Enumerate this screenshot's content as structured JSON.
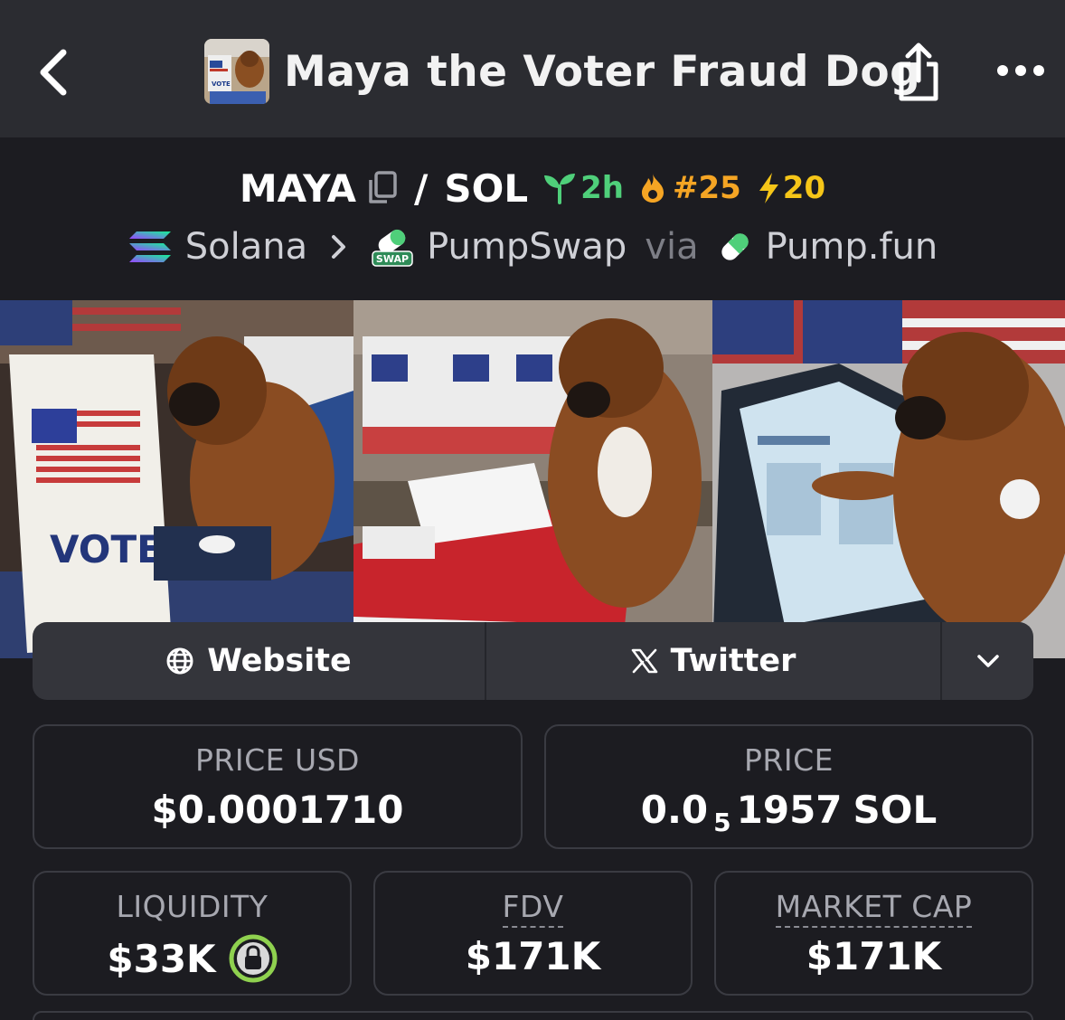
{
  "header": {
    "title": "Maya the Voter Fraud Dog",
    "back_icon": "chevron-left-icon",
    "share_icon": "share-icon",
    "more_icon": "more-horizontal-icon",
    "avatar_text": "VOTE"
  },
  "pair": {
    "base": "MAYA",
    "quote": "SOL",
    "separator": "/",
    "age": "2h",
    "rank": "#25",
    "boosts": "20",
    "colors": {
      "age": "#4fcf7a",
      "rank": "#f5a524",
      "boosts": "#f5c518"
    }
  },
  "chain": {
    "network": "Solana",
    "dex": "PumpSwap",
    "dex_badge": "SWAP",
    "via": "via",
    "launchpad": "Pump.fun"
  },
  "banner": {
    "left_sign": "VOTE"
  },
  "links": {
    "website": "Website",
    "twitter": "Twitter"
  },
  "stats": {
    "price_usd_label": "PRICE USD",
    "price_usd_value": "$0.0001710",
    "price_label": "PRICE",
    "price_prefix": "0.0",
    "price_zeros": "5",
    "price_digits": "1957",
    "price_unit": "SOL",
    "liquidity_label": "LIQUIDITY",
    "liquidity_value": "$33K",
    "fdv_label": "FDV",
    "fdv_value": "$171K",
    "mcap_label": "MARKET CAP",
    "mcap_value": "$171K"
  }
}
